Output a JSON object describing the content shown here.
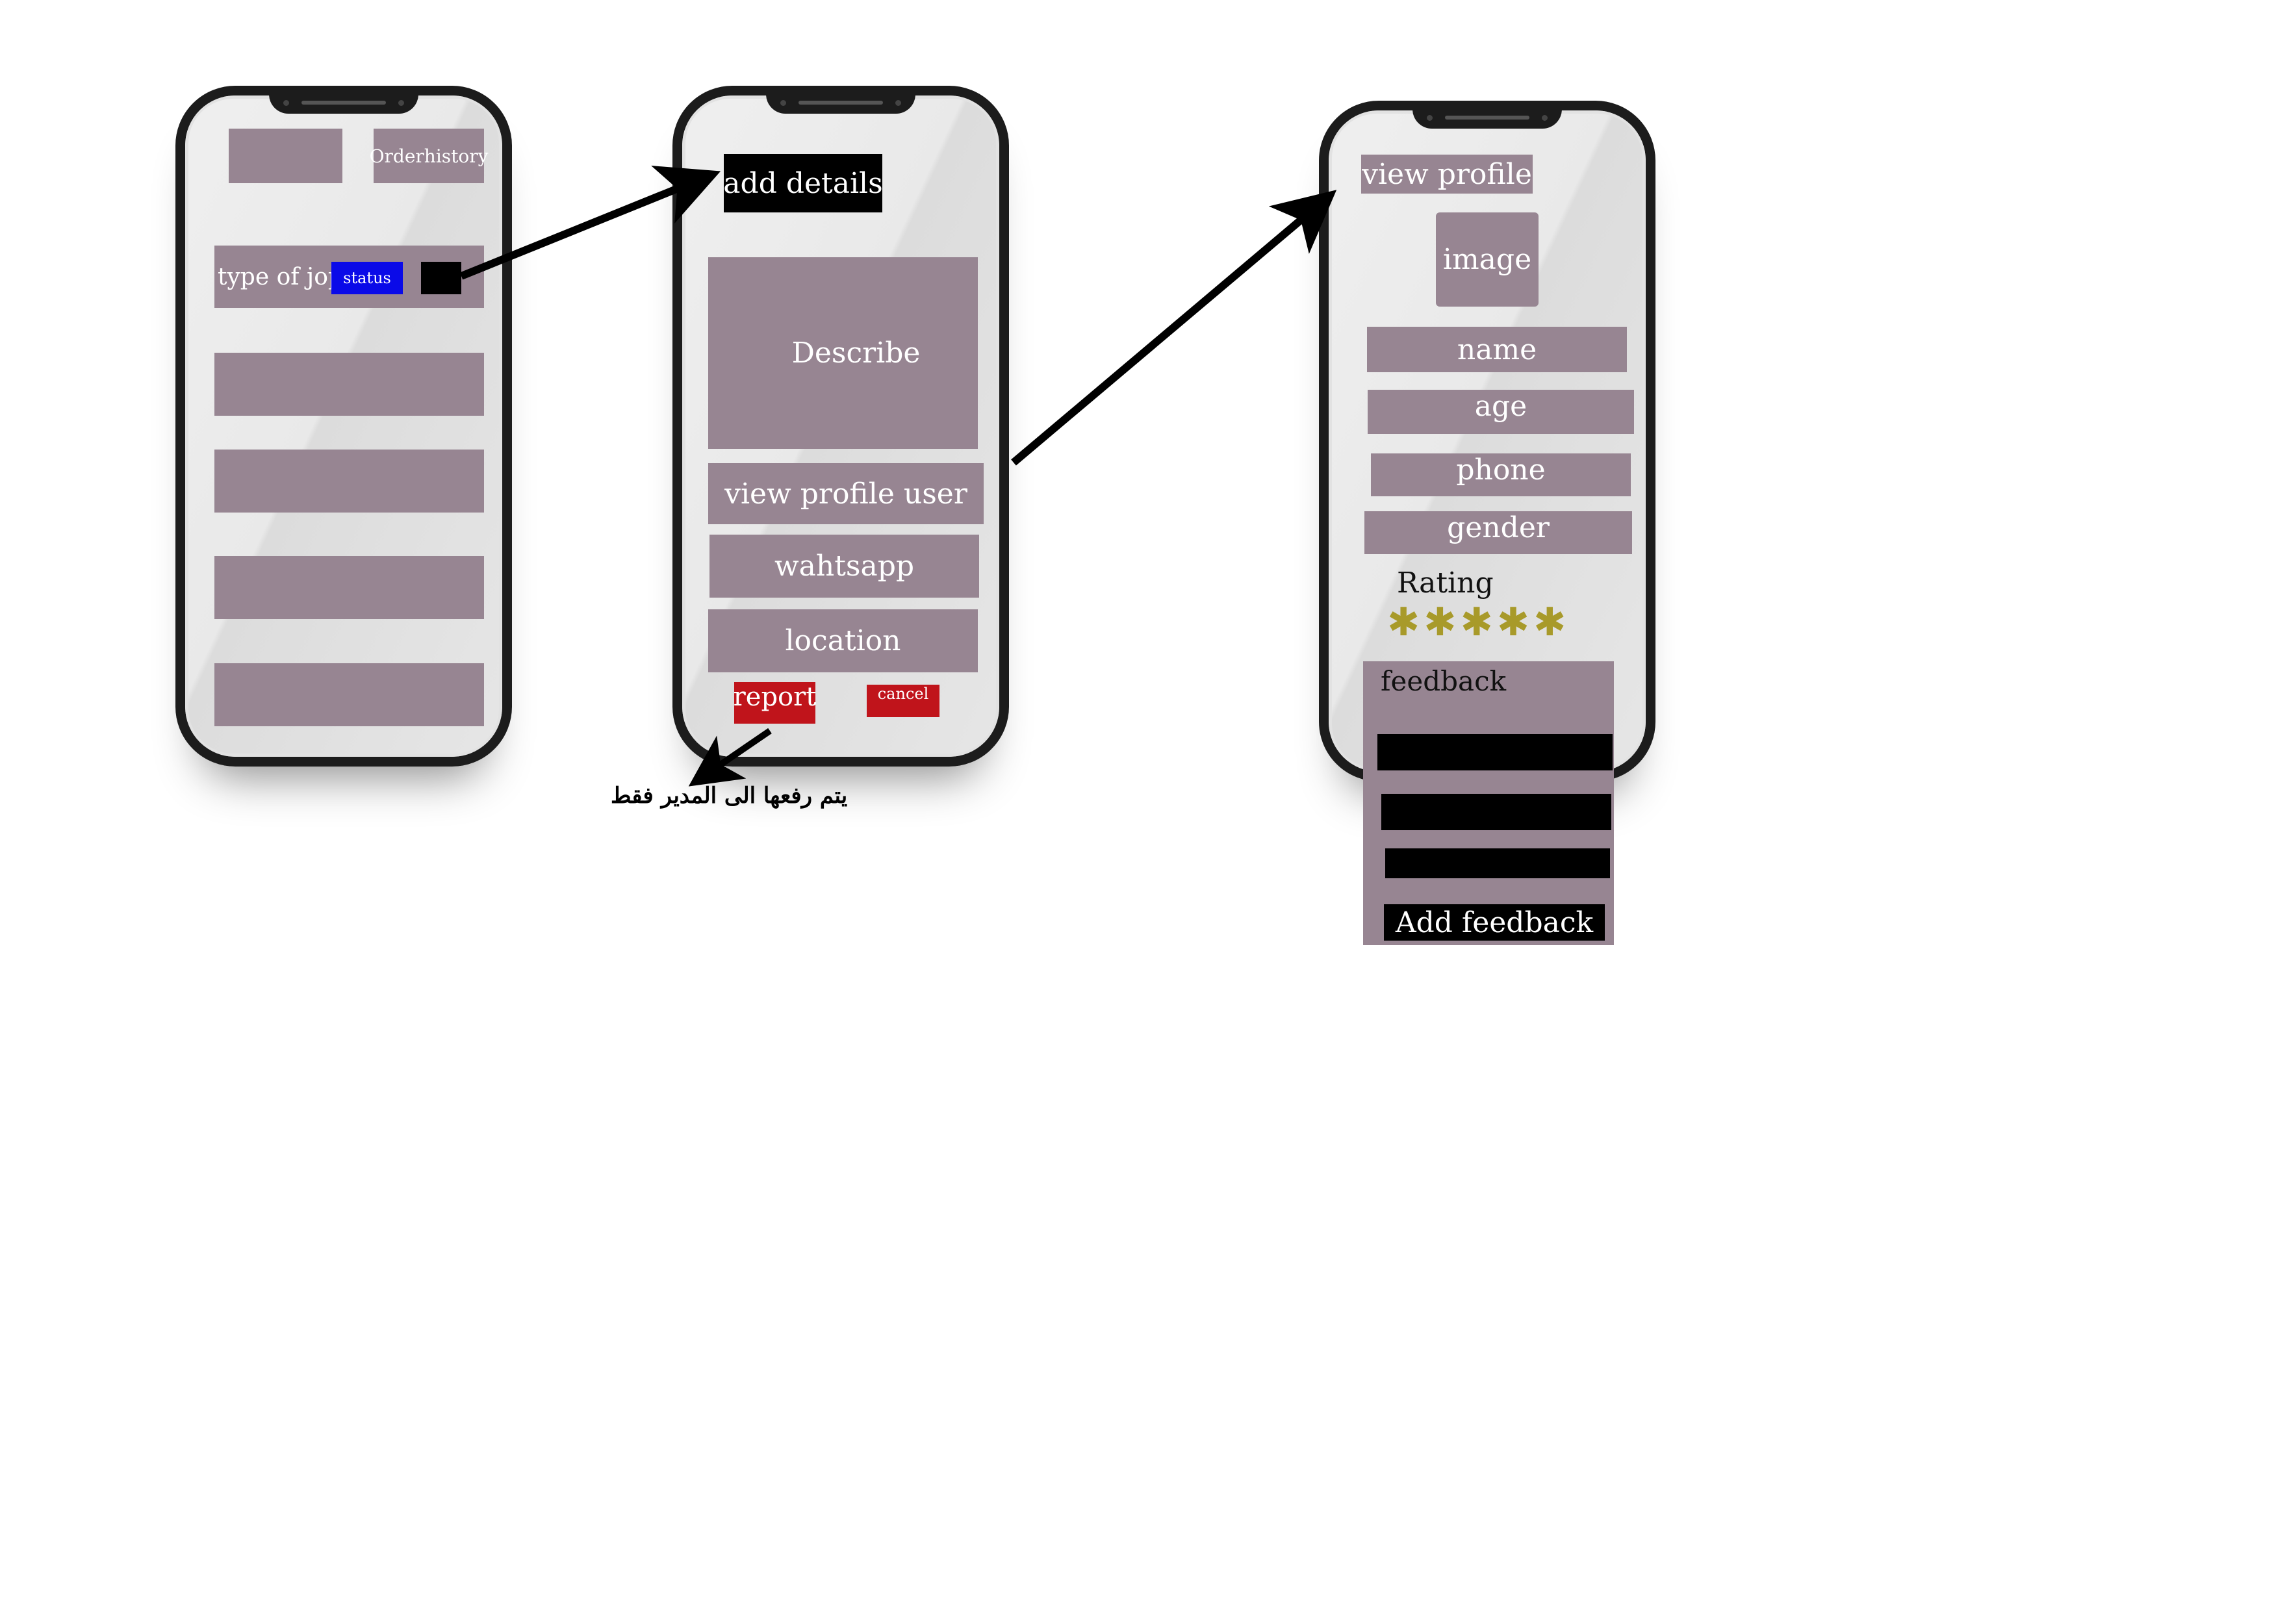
{
  "screen1": {
    "order_history_label": "Orderhistory",
    "job_type_label": "type of jop",
    "status_label": "status"
  },
  "screen2": {
    "add_details_label": "add details",
    "describe_label": "Describe",
    "view_profile_user_label": "view profile  user",
    "whatsapp_label": "wahtsapp",
    "location_label": "location",
    "report_label": "report",
    "cancel_label": "cancel",
    "report_note": "يتم رفعها الى المدير فقط"
  },
  "screen3": {
    "view_profile_label": "view profile",
    "image_label": "image",
    "name_label": "name",
    "age_label": "age",
    "phone_label": "phone",
    "gender_label": "gender",
    "rating_label": "Rating",
    "rating_value": 5,
    "rating_max": 5,
    "feedback_label": "feedback",
    "add_feedback_label": "Add  feedback"
  },
  "colors": {
    "block": "#978592",
    "black": "#000000",
    "red": "#c0141b",
    "blue": "#0a0ae8",
    "star": "#a89a2a"
  }
}
